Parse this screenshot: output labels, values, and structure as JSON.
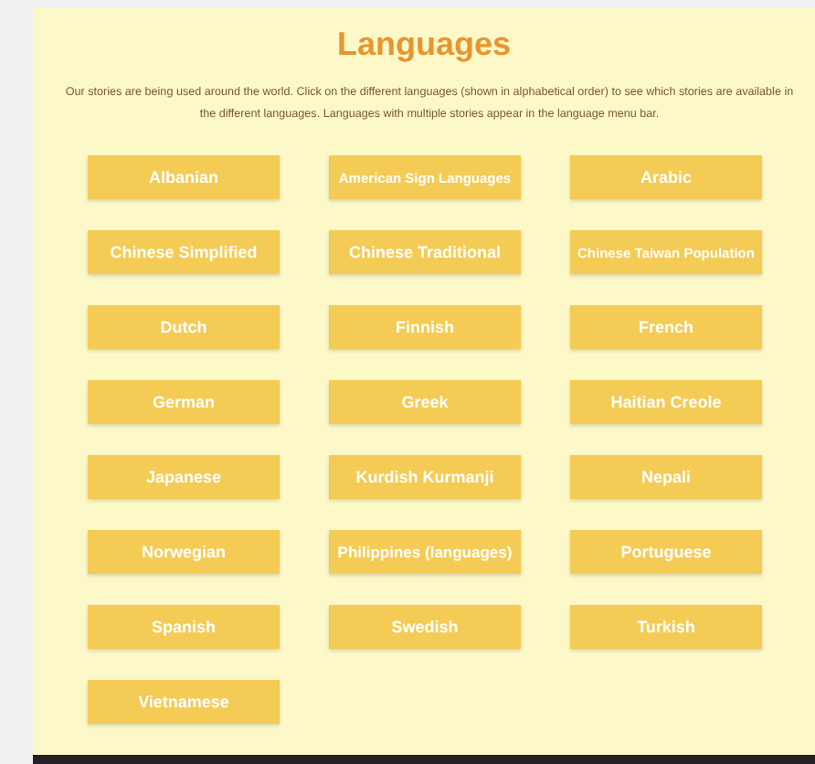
{
  "title": "Languages",
  "intro": "Our stories are being used around the world.   Click on the different languages (shown in alphabetical order) to see which stories are available in the different languages. Languages with multiple stories appear in the language menu bar.",
  "languages": [
    "Albanian",
    "American Sign Languages",
    "Arabic",
    "Chinese Simplified",
    "Chinese Traditional",
    "Chinese Taiwan Population",
    "Dutch",
    "Finnish",
    "French",
    "German",
    "Greek",
    "Haitian Creole",
    "Japanese",
    "Kurdish Kurmanji",
    "Nepali",
    "Norwegian",
    "Philippines (languages)",
    "Portuguese",
    "Spanish",
    "Swedish",
    "Turkish",
    "Vietnamese"
  ]
}
